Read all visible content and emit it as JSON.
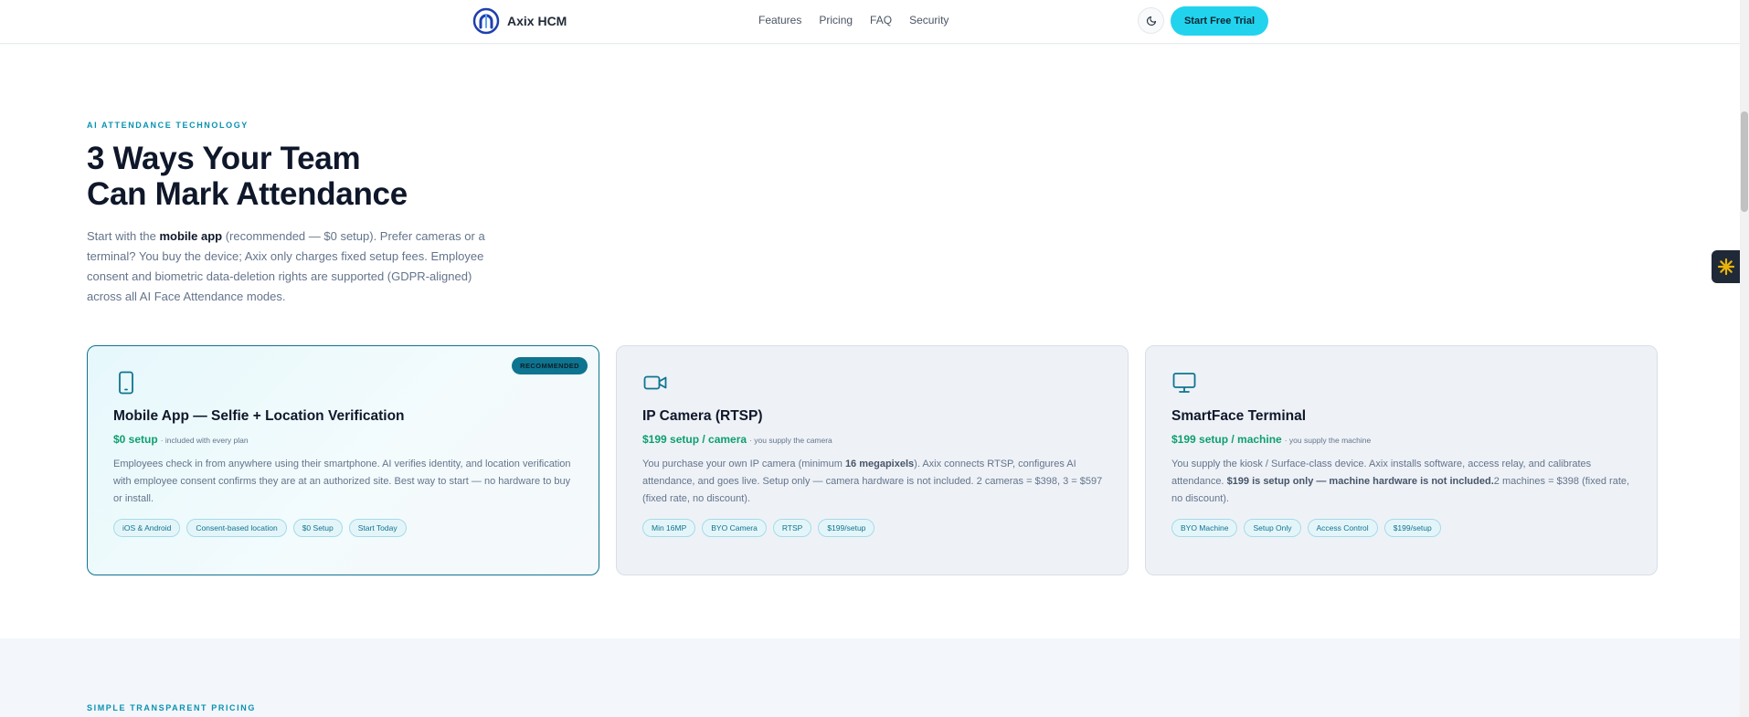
{
  "nav": {
    "brand": "Axix HCM",
    "links": [
      "Features",
      "Pricing",
      "FAQ",
      "Security"
    ],
    "cta": "Start Free Trial",
    "icons": {
      "logo": "arch-logo",
      "theme": "moon-icon"
    }
  },
  "hero": {
    "eyebrow": "AI ATTENDANCE TECHNOLOGY",
    "title_line1": "3 Ways Your Team",
    "title_line2": "Can Mark Attendance",
    "desc_pre": "Start with the ",
    "desc_strong": "mobile app",
    "desc_post": " (recommended — $0 setup). Prefer cameras or a terminal? You buy the device; Axix only charges fixed setup fees. Employee consent and biometric data-deletion rights are supported (GDPR-aligned) across all AI Face Attendance modes."
  },
  "cards": [
    {
      "badge": "RECOMMENDED",
      "icon": "smartphone-icon",
      "title": "Mobile App — Selfie + Location Verification",
      "price": "$0 setup",
      "price_note": "· included with every plan",
      "desc_a": "Employees check in from anywhere using their smartphone. AI verifies identity, and location verification with employee consent confirms they are at an authorized site. Best way to start — no hardware to buy or install.",
      "tags": [
        "iOS & Android",
        "Consent-based location",
        "$0 Setup",
        "Start Today"
      ]
    },
    {
      "icon": "video-camera-icon",
      "title": "IP Camera (RTSP)",
      "price": "$199 setup / camera",
      "price_note": "· you supply the camera",
      "desc_a": "You purchase your own IP camera (minimum ",
      "desc_strong": "16 megapixels",
      "desc_b": "). Axix connects RTSP, configures AI attendance, and goes live. Setup only — camera hardware is not included. 2 cameras = $398, 3 = $597 (fixed rate, no discount).",
      "tags": [
        "Min 16MP",
        "BYO Camera",
        "RTSP",
        "$199/setup"
      ]
    },
    {
      "icon": "monitor-icon",
      "title": "SmartFace Terminal",
      "price": "$199 setup / machine",
      "price_note": "· you supply the machine",
      "desc_a": "You supply the kiosk / Surface-class device. Axix installs software, access relay, and calibrates attendance. ",
      "desc_strong": "$199 is setup only — machine hardware is not included.",
      "desc_b": "2 machines = $398 (fixed rate, no discount).",
      "tags": [
        "BYO Machine",
        "Setup Only",
        "Access Control",
        "$199/setup"
      ]
    }
  ],
  "pricing": {
    "eyebrow": "SIMPLE TRANSPARENT PRICING"
  },
  "colors": {
    "accent": "#22d3ee",
    "primary": "#0e7490",
    "price": "#0e9f6e",
    "text": "#0f172a",
    "muted": "#64748b"
  }
}
